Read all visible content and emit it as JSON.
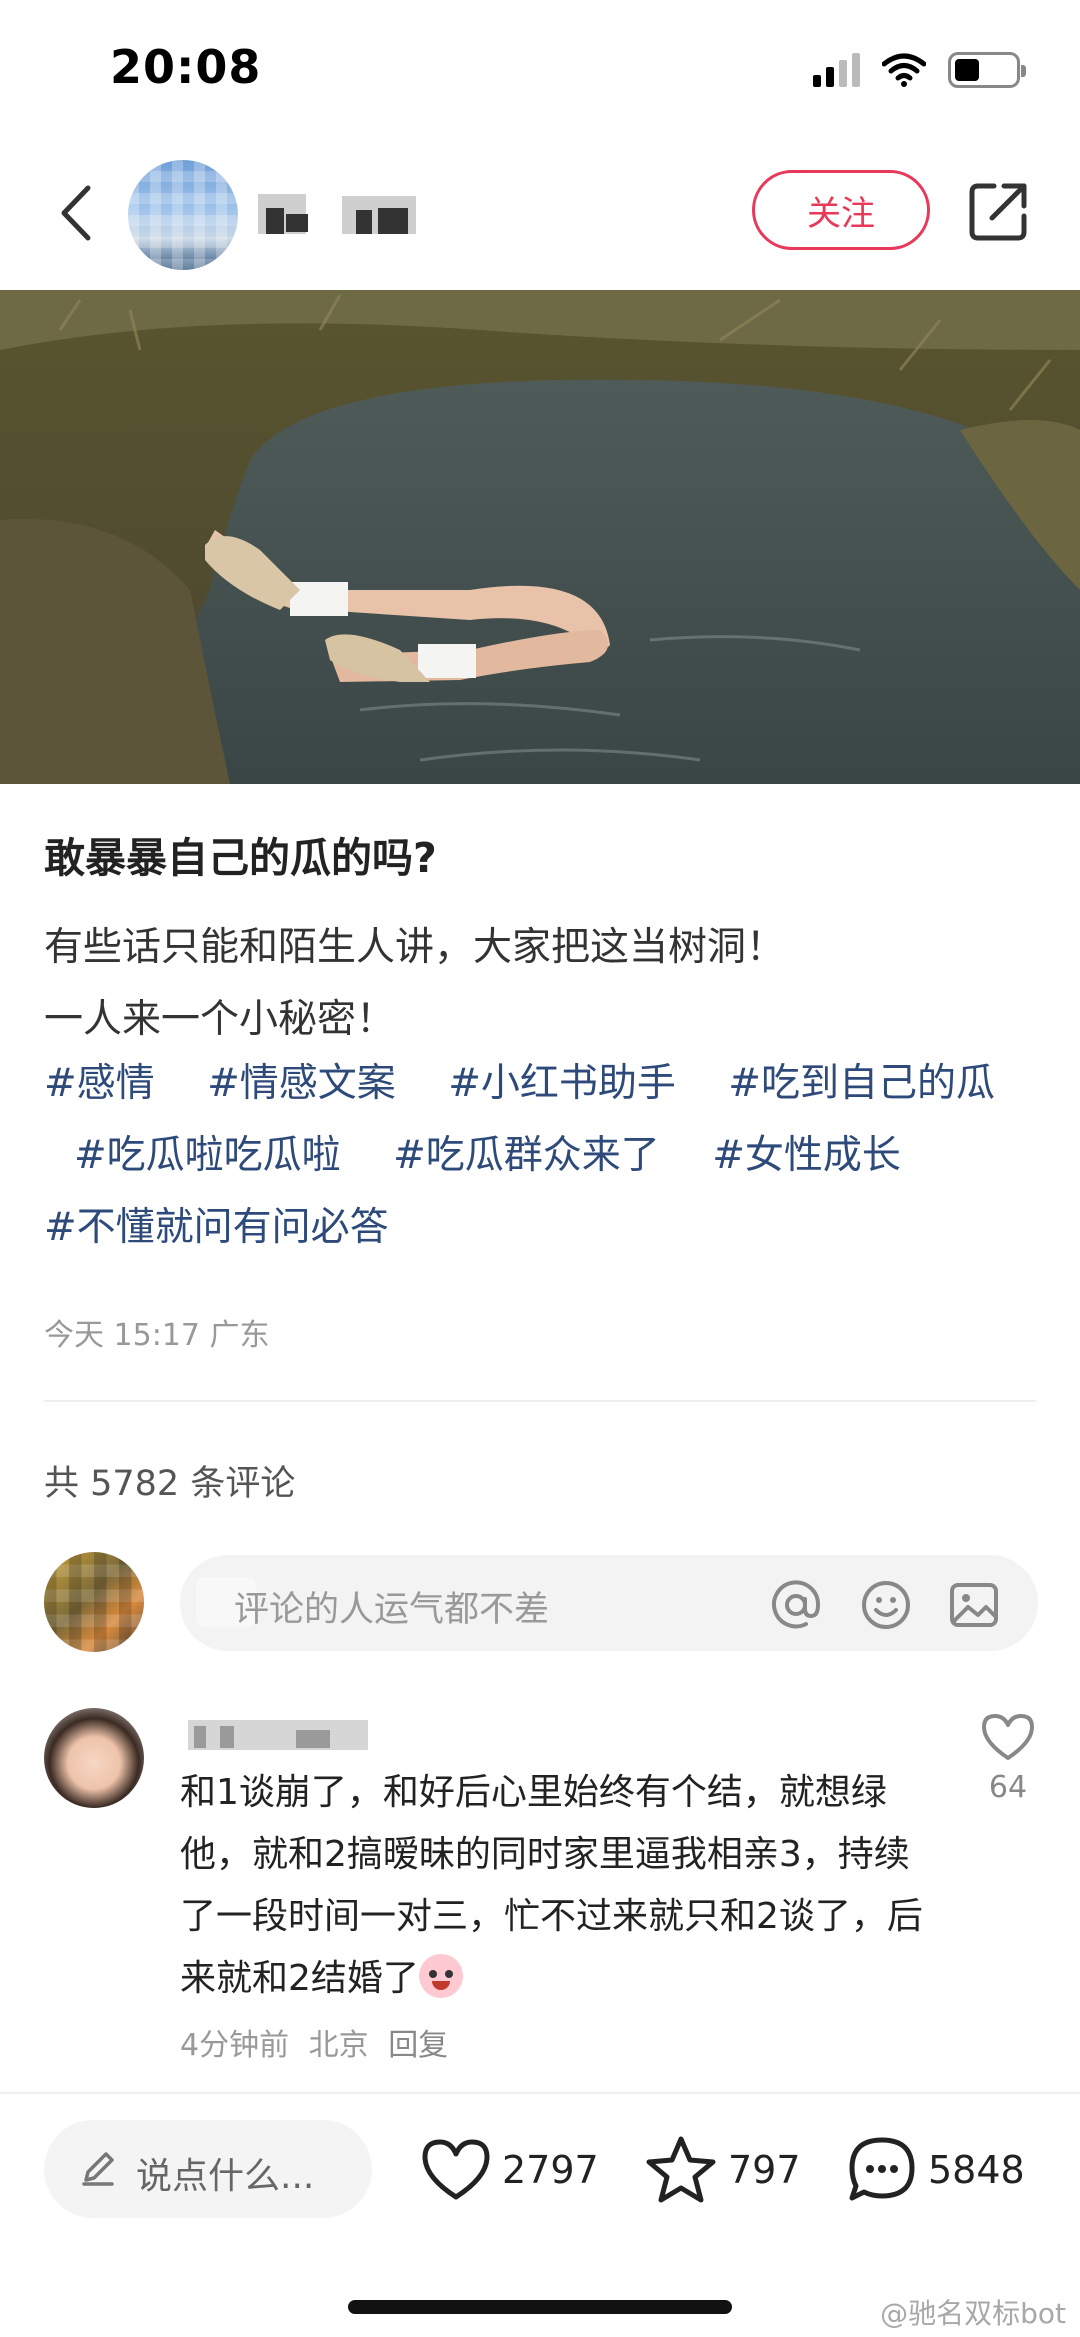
{
  "status_bar": {
    "time": "20:08",
    "signal_bars_filled": 2,
    "signal_bars_total": 4,
    "battery_level": 0.35
  },
  "header": {
    "follow_label": "关注",
    "back_icon": "chevron-left-icon",
    "share_icon": "share-icon"
  },
  "post": {
    "title": "敢暴暴自己的瓜的吗?",
    "body_lines": [
      "有些话只能和陌生人讲，大家把这当树洞！",
      "一人来一个小秘密！"
    ],
    "tags": [
      "#感情",
      "#情感文案",
      "#小红书助手",
      "#吃到自己的瓜",
      "#吃瓜啦吃瓜啦",
      "#吃瓜群众来了",
      "#女性成长",
      "#不懂就问有问必答"
    ],
    "meta": "今天 15:17 广东"
  },
  "comments": {
    "count_label": "共 5782 条评论",
    "input_placeholder": "评论的人运气都不差",
    "input_icons": [
      "at-icon",
      "emoji-icon",
      "image-icon"
    ],
    "items": [
      {
        "text": "和1谈崩了，和好后心里始终有个结，就想绿他，就和2搞暧昧的同时家里逼我相亲3，持续了一段时间一对三，忙不过来就只和2谈了，后来就和2结婚了",
        "time": "4分钟前",
        "location": "北京",
        "reply_label": "回复",
        "likes": "64"
      }
    ]
  },
  "bottom_bar": {
    "say_placeholder": "说点什么...",
    "likes": "2797",
    "favorites": "797",
    "comments": "5848"
  },
  "watermark": "@驰名双标bot",
  "colors": {
    "accent": "#e8395a",
    "tag": "#2d4a7a",
    "muted": "#999999"
  }
}
